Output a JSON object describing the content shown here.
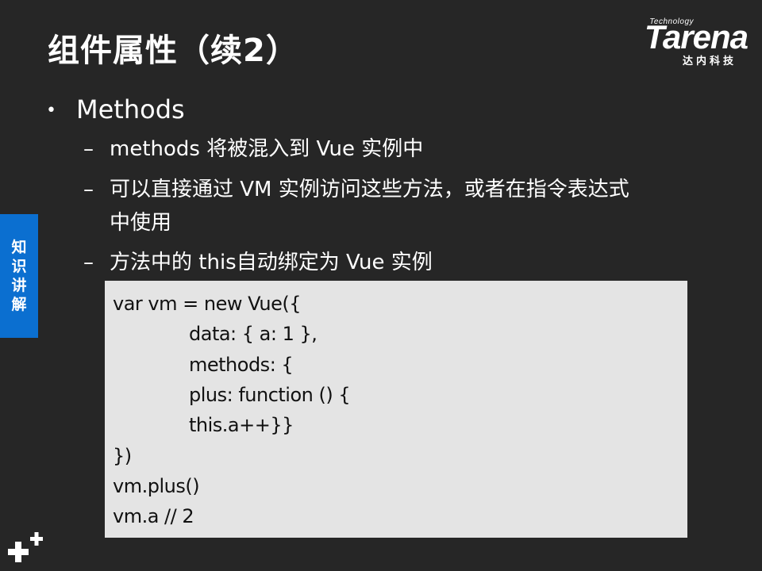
{
  "slide": {
    "title": "组件属性（续2）",
    "logo": {
      "tagline": "Technology",
      "brand": "Tarena",
      "chinese": "达内科技"
    },
    "side_tab": [
      "知",
      "识",
      "讲",
      "解"
    ],
    "bullet": {
      "marker": "•",
      "text": "Methods"
    },
    "sub_items": [
      {
        "marker": "–",
        "text": "methods 将被混入到 Vue 实例中"
      },
      {
        "marker": "–",
        "text": "可以直接通过 VM 实例访问这些方法，或者在指令表达式",
        "continuation": "中使用"
      },
      {
        "marker": "–",
        "text": "方法中的 this自动绑定为 Vue 实例"
      }
    ],
    "code_lines": [
      "var vm = new Vue({",
      "data: { a: 1 },",
      "methods: {",
      "plus: function () {",
      "this.a++}}",
      "})",
      "vm.plus()",
      "vm.a // 2"
    ],
    "colors": {
      "background": "#262626",
      "side_tab": "#0b6fd0",
      "code_background": "#e4e4e4"
    },
    "icons": {
      "bottom_left": "plus-cluster-icon"
    }
  }
}
